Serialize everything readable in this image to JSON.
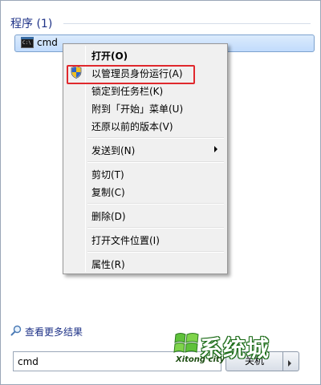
{
  "programs": {
    "title": "程序 (1)",
    "result": {
      "label": "cmd",
      "icon": "cmd-console-icon"
    }
  },
  "context_menu": {
    "items": [
      {
        "label": "打开(O)",
        "bold": true
      },
      {
        "label": "以管理员身份运行(A)",
        "icon": "uac-shield-icon",
        "highlighted": true
      },
      {
        "label": "锁定到任务栏(K)"
      },
      {
        "label": "附到「开始」菜单(U)"
      },
      {
        "label": "还原以前的版本(V)"
      },
      {
        "label": "发送到(N)",
        "submenu": true
      },
      {
        "label": "剪切(T)"
      },
      {
        "label": "复制(C)"
      },
      {
        "label": "删除(D)"
      },
      {
        "label": "打开文件位置(I)"
      },
      {
        "label": "属性(R)"
      }
    ],
    "highlight_color": "#e0282d"
  },
  "footer": {
    "see_more": "查看更多结果",
    "search_value": "cmd",
    "shutdown_label": "关机"
  },
  "watermark": {
    "text": "系统城",
    "subtext": "Xitong city",
    "color": "#3aa531"
  }
}
